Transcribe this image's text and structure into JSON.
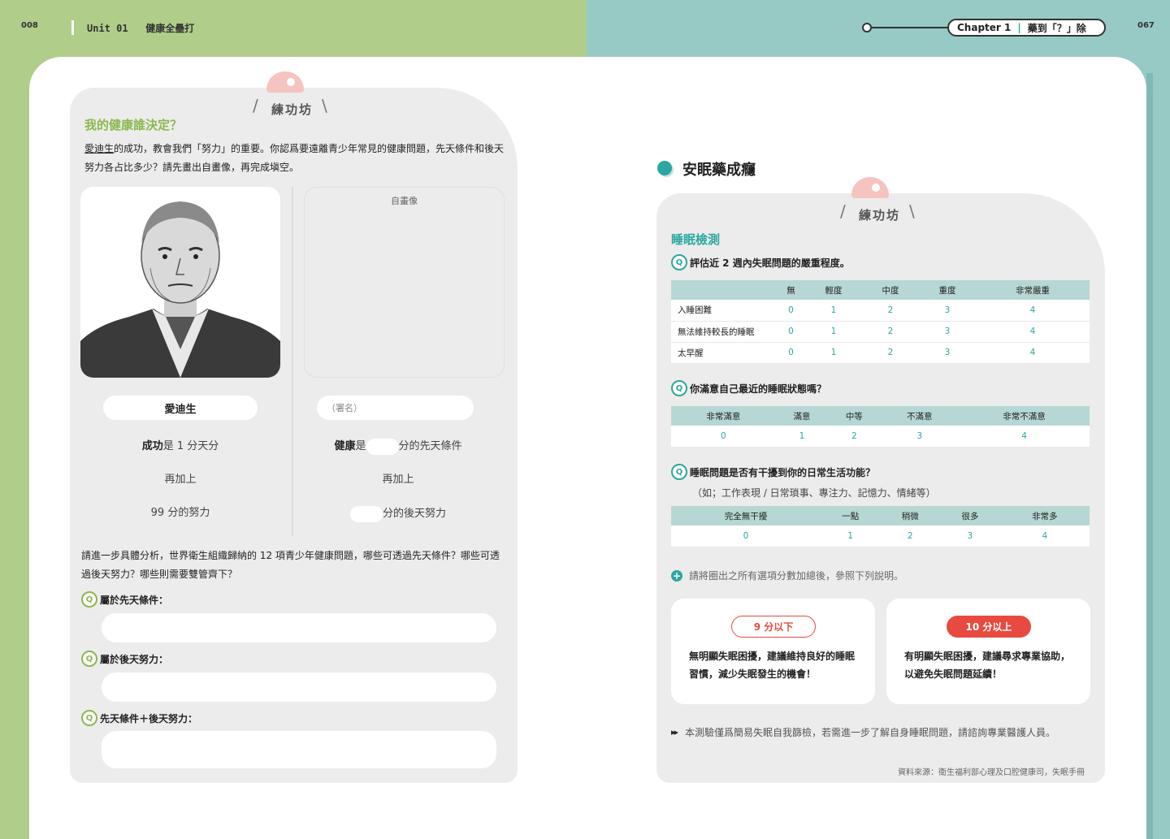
{
  "header": {
    "page_left": "008",
    "unit": "Unit 01",
    "unit_title": "健康全壘打",
    "chapter": "Chapter 1",
    "chapter_title": "藥到「？」除",
    "page_right": "067"
  },
  "left": {
    "tag": "練功坊",
    "title": "我的健康誰決定？",
    "intro_underlined": "愛迪生",
    "intro": "的成功，教會我們「努力」的重要。你認爲要遠離青少年常見的健康問題，先天條件和後天努力各占比多少？請先畫出自畫像，再完成塡空。",
    "self_portrait_label": "自畫像",
    "edison_name": "愛迪生",
    "sign_placeholder": "（署名）",
    "edison_line1_bold": "成功",
    "edison_line1": "是 1 分天分",
    "edison_line2": "再加上",
    "edison_line3": "99 分的努力",
    "self_line1_bold": "健康",
    "self_line1_a": "是",
    "self_line1_b": "分的先天條件",
    "self_line2": "再加上",
    "self_line3": "分的後天努力",
    "question2": "請進一步具體分析，世界衛生組織歸納的 12 項青少年健康問題，哪些可透過先天條件？哪些可透過後天努力？哪些則需要雙管齊下？",
    "q_icon": "Q",
    "answers": [
      {
        "label": "屬於先天條件："
      },
      {
        "label": "屬於後天努力："
      },
      {
        "label": "先天條件＋後天努力："
      }
    ]
  },
  "right": {
    "section_title": "安眠藥成癮",
    "tag": "練功坊",
    "title": "睡眠檢測",
    "q1": "評估近 2 週內失眠問題的嚴重程度。",
    "table1": {
      "headers": [
        "",
        "無",
        "輕度",
        "中度",
        "重度",
        "非常嚴重"
      ],
      "rows": [
        [
          "入睡困難",
          "0",
          "1",
          "2",
          "3",
          "4"
        ],
        [
          "無法維持較長的睡眠",
          "0",
          "1",
          "2",
          "3",
          "4"
        ],
        [
          "太早醒",
          "0",
          "1",
          "2",
          "3",
          "4"
        ]
      ]
    },
    "q2": "你滿意自己最近的睡眠狀態嗎？",
    "table2": {
      "headers": [
        "非常滿意",
        "滿意",
        "中等",
        "不滿意",
        "非常不滿意"
      ],
      "values": [
        "0",
        "1",
        "2",
        "3",
        "4"
      ]
    },
    "q3": "睡眠問題是否有干擾到你的日常生活功能？",
    "q3_sub": "（如；工作表現 / 日常瑣事、專注力、記憶力、情緒等）",
    "table3": {
      "headers": [
        "完全無干擾",
        "一點",
        "稍微",
        "很多",
        "非常多"
      ],
      "values": [
        "0",
        "1",
        "2",
        "3",
        "4"
      ]
    },
    "note": "請將圈出之所有選項分數加總後，參照下列說明。",
    "result_low_badge": "9 分以下",
    "result_low_text": "無明顯失眠困擾，建議維持良好的睡眠習慣，減少失眠發生的機會！",
    "result_high_badge": "10 分以上",
    "result_high_text": "有明顯失眠困擾，建議尋求專業協助，以避免失眠問題延續！",
    "disclaimer": "本測驗僅爲簡易失眠自我篩檢，若需進一步了解自身睡眠問題，請諮詢專業醫護人員。",
    "source": "資料來源：衛生福利部心理及口腔健康司，失眠手冊"
  },
  "colors": {
    "green": "#8bb84e",
    "teal": "#2aa7a0",
    "red": "#e84a3f",
    "band_left": "#b1cd8a",
    "band_right": "#97c9c5"
  }
}
